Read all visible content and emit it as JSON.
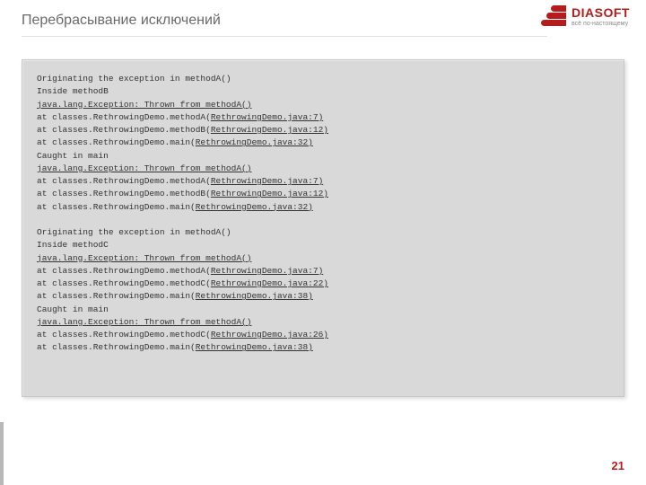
{
  "title": "Перебрасывание исключений",
  "logo": {
    "name": "DIASOFT",
    "tagline": "всё по-настоящему"
  },
  "code_lines": [
    {
      "pre": "Originating the exception in methodA()"
    },
    {
      "pre": "Inside methodB"
    },
    {
      "pre": "",
      "u": "java.lang.Exception: Thrown from methodA()"
    },
    {
      "pre": "at classes.RethrowingDemo.methodA(",
      "u": "RethrowingDemo.java:7)"
    },
    {
      "pre": "at classes.RethrowingDemo.methodB(",
      "u": "RethrowingDemo.java:12)"
    },
    {
      "pre": "at classes.RethrowingDemo.main(",
      "u": "RethrowingDemo.java:32)"
    },
    {
      "pre": "Caught in main"
    },
    {
      "pre": "",
      "u": "java.lang.Exception: Thrown from methodA()"
    },
    {
      "pre": "at classes.RethrowingDemo.methodA(",
      "u": "RethrowingDemo.java:7)"
    },
    {
      "pre": "at classes.RethrowingDemo.methodB(",
      "u": "RethrowingDemo.java:12)"
    },
    {
      "pre": "at classes.RethrowingDemo.main(",
      "u": "RethrowingDemo.java:32)"
    },
    {
      "pre": ""
    },
    {
      "pre": "Originating the exception in methodA()"
    },
    {
      "pre": "Inside methodC"
    },
    {
      "pre": "",
      "u": "java.lang.Exception: Thrown from methodA()"
    },
    {
      "pre": "at classes.RethrowingDemo.methodA(",
      "u": "RethrowingDemo.java:7)"
    },
    {
      "pre": "at classes.RethrowingDemo.methodC(",
      "u": "RethrowingDemo.java:22)"
    },
    {
      "pre": "at classes.RethrowingDemo.main(",
      "u": "RethrowingDemo.java:38)"
    },
    {
      "pre": "Caught in main"
    },
    {
      "pre": "",
      "u": "java.lang.Exception: Thrown from methodA()"
    },
    {
      "pre": "at classes.RethrowingDemo.methodC(",
      "u": "RethrowingDemo.java:26)"
    },
    {
      "pre": "at classes.RethrowingDemo.main(",
      "u": "RethrowingDemo.java:38)"
    }
  ],
  "page_number": "21"
}
